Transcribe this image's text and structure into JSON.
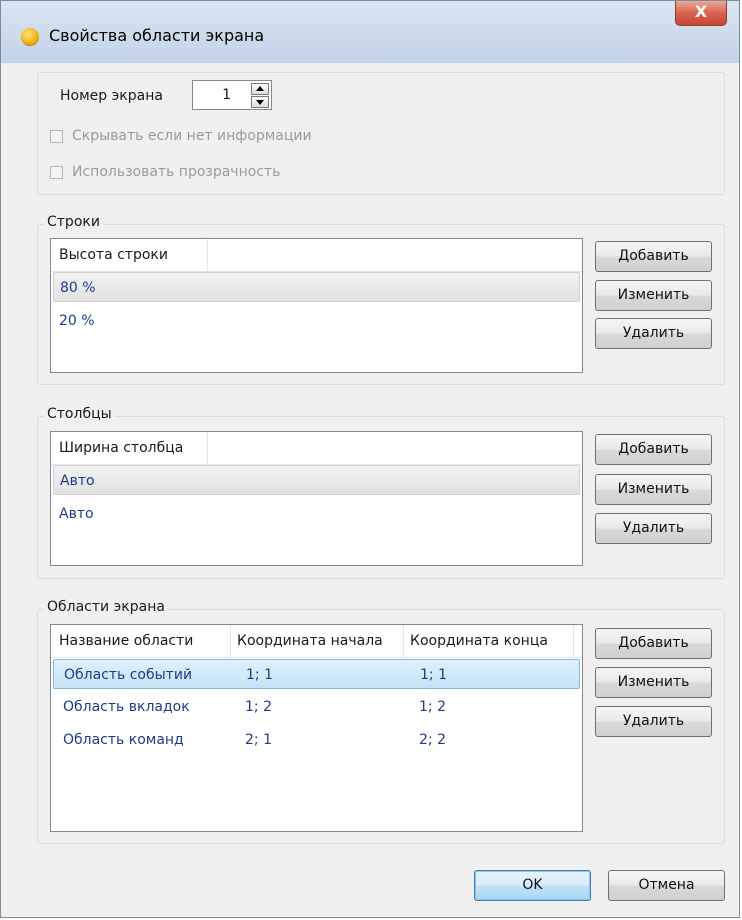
{
  "window": {
    "title": "Свойства области экрана",
    "close_label": "X"
  },
  "screen": {
    "number_label": "Номер экрана",
    "number_value": "1"
  },
  "options": {
    "hide_if_no_info": "Скрывать если нет информации",
    "use_transparency": "Использовать прозрачность"
  },
  "rows_group": {
    "title": "Строки",
    "column_header": "Высота строки",
    "items": [
      "80 %",
      "20 %"
    ]
  },
  "cols_group": {
    "title": "Столбцы",
    "column_header": "Ширина столбца",
    "items": [
      "Авто",
      "Авто"
    ]
  },
  "areas_group": {
    "title": "Области экрана",
    "headers": [
      "Название области",
      "Координата начала",
      "Координата конца"
    ],
    "rows": [
      [
        "Область событий",
        "1; 1",
        "1; 1"
      ],
      [
        "Область вкладок",
        "1; 2",
        "1; 2"
      ],
      [
        "Область команд",
        "2; 1",
        "2; 2"
      ]
    ]
  },
  "buttons": {
    "add": "Добавить",
    "edit": "Изменить",
    "delete": "Удалить",
    "ok": "OK",
    "cancel": "Отмена"
  }
}
